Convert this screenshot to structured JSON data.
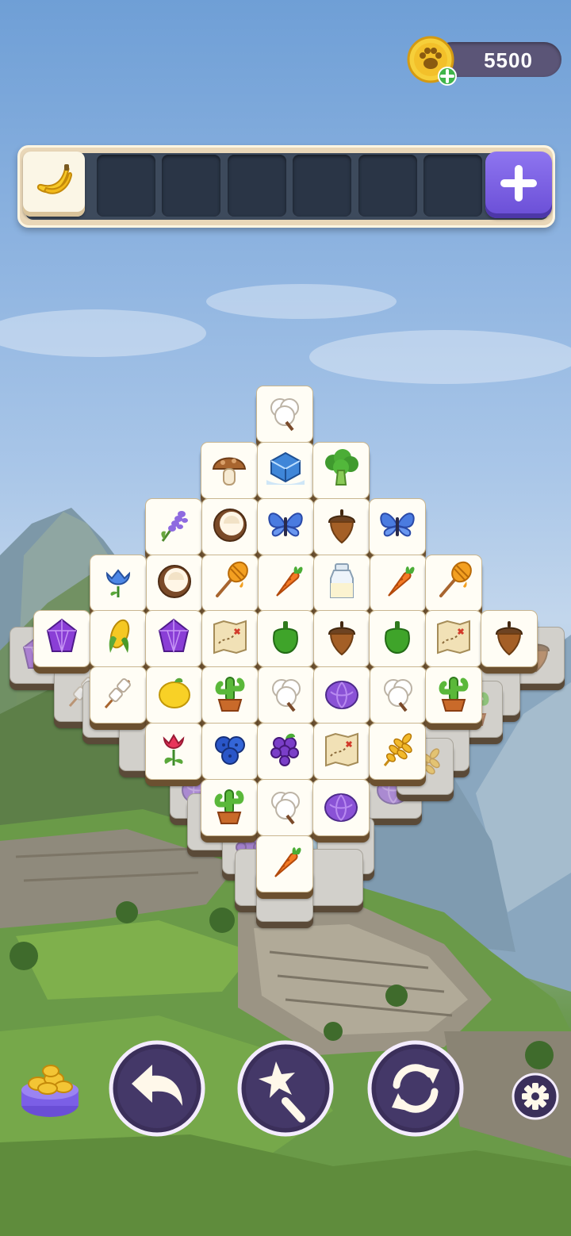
{
  "hud": {
    "coins": "5500",
    "coin_icon": "paw-coin-icon",
    "add_coins_icon": "plus-badge-icon"
  },
  "tray": {
    "slots_total": 7,
    "filled": [
      "banana"
    ],
    "add_slot_icon": "plus-icon"
  },
  "board": {
    "top_layer_rows": [
      [
        "cotton"
      ],
      [
        "mushroom",
        "ice-cube",
        "broccoli"
      ],
      [
        "lavender",
        "coconut",
        "butterfly",
        "acorn",
        "butterfly"
      ],
      [
        "bellflower",
        "coconut",
        "honey-dipper",
        "carrot",
        "milk-bottle",
        "carrot",
        "honey-dipper"
      ],
      [
        "amethyst",
        "corn",
        "amethyst",
        "treasure-map",
        "green-pepper",
        "acorn",
        "green-pepper",
        "treasure-map",
        "acorn"
      ],
      [
        "marshmallow",
        "lemon",
        "cactus",
        "cotton",
        "purple-cabbage",
        "cotton",
        "cactus"
      ],
      [
        "tulip",
        "blueberries",
        "grapes",
        "treasure-map",
        "wheat"
      ],
      [
        "cactus",
        "cotton",
        "purple-cabbage"
      ],
      [
        "carrot"
      ]
    ]
  },
  "controls": {
    "undo_icon": "undo-icon",
    "magic_wand_icon": "magic-wand-icon",
    "shuffle_icon": "shuffle-icon",
    "settings_icon": "gear-icon",
    "coin_bank_icon": "coin-bank-icon"
  },
  "colors": {
    "button_purple": "#3b2f5a",
    "button_border": "#f4ecff",
    "tray_add": "#7b5fe6",
    "coin_gold": "#f3c535"
  }
}
